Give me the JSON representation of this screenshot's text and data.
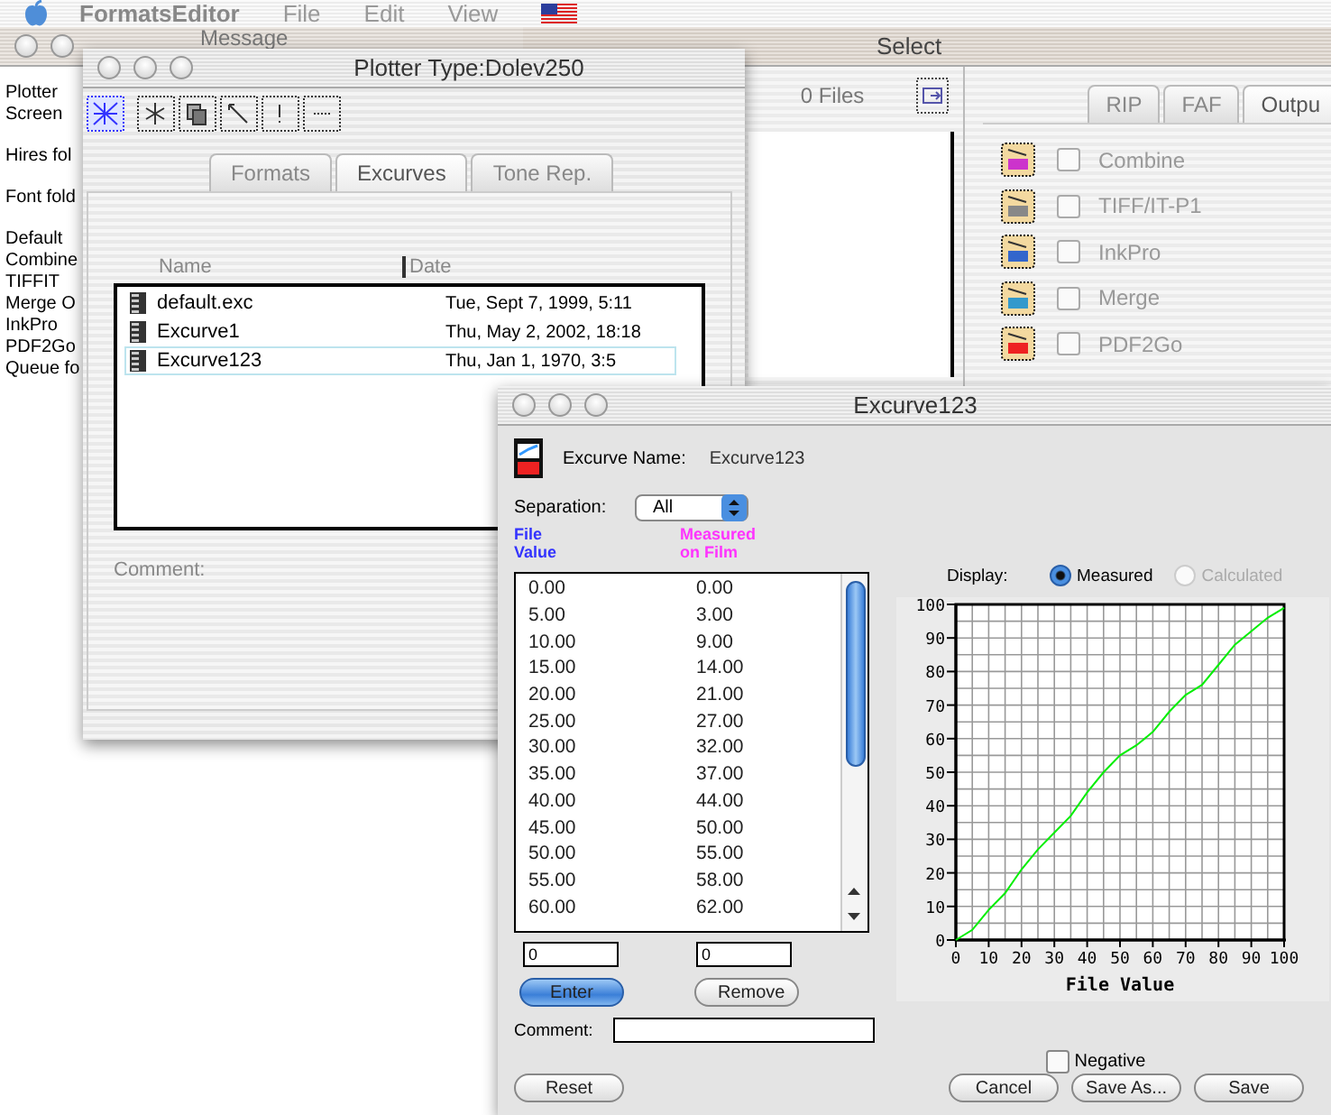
{
  "menu_bar": {
    "app_name": "FormatsEditor",
    "items": [
      "File",
      "Edit",
      "View"
    ]
  },
  "messages_window": {
    "title": "Message",
    "line_groups": [
      [
        "Plotter",
        "Screen"
      ],
      [
        "Hires fol"
      ],
      [
        "Font fold"
      ],
      [
        "Default",
        "Combine",
        "TIFFIT",
        "Merge O",
        "InkPro",
        "PDF2Go",
        "Queue fo"
      ]
    ]
  },
  "select_window": {
    "title": "Select",
    "file_count": "0 Files",
    "tabs": [
      {
        "label": "RIP",
        "selected": false
      },
      {
        "label": "FAF",
        "selected": false
      },
      {
        "label": "Outpu",
        "selected": true
      }
    ],
    "outputs": [
      {
        "label": "Combine",
        "checked": false,
        "color": "#cc33cc"
      },
      {
        "label": "TIFF/IT-P1",
        "checked": false,
        "color": "#888888"
      },
      {
        "label": "InkPro",
        "checked": false,
        "color": "#3366cc"
      },
      {
        "label": "Merge",
        "checked": false,
        "color": "#3399cc"
      },
      {
        "label": "PDF2Go",
        "checked": false,
        "color": "#ee2222"
      }
    ]
  },
  "plotter_window": {
    "title": "Plotter Type:Dolev250",
    "tabs": [
      {
        "label": "Formats",
        "selected": false
      },
      {
        "label": "Excurves",
        "selected": true
      },
      {
        "label": "Tone Rep.",
        "selected": false
      }
    ],
    "columns": [
      "Name",
      "Date"
    ],
    "files": [
      {
        "name": "default.exc",
        "date": "Tue, Sept 7, 1999, 5:11",
        "selected": false
      },
      {
        "name": "Excurve1",
        "date": "Thu, May 2, 2002, 18:18",
        "selected": false
      },
      {
        "name": "Excurve123",
        "date": "Thu, Jan 1, 1970, 3:5",
        "selected": true
      }
    ],
    "comment_label": "Comment:"
  },
  "excurve_window": {
    "title": "Excurve123",
    "name_label": "Excurve Name:",
    "name_value": "Excurve123",
    "separation_label": "Separation:",
    "separation_value": "All",
    "columns": [
      {
        "lines": [
          "File",
          "Value"
        ],
        "color": "#3333ff"
      },
      {
        "lines": [
          "Measured",
          "on Film"
        ],
        "color": "#ff33ff"
      }
    ],
    "rows": [
      [
        "0.00",
        "0.00"
      ],
      [
        "5.00",
        "3.00"
      ],
      [
        "10.00",
        "9.00"
      ],
      [
        "15.00",
        "14.00"
      ],
      [
        "20.00",
        "21.00"
      ],
      [
        "25.00",
        "27.00"
      ],
      [
        "30.00",
        "32.00"
      ],
      [
        "35.00",
        "37.00"
      ],
      [
        "40.00",
        "44.00"
      ],
      [
        "45.00",
        "50.00"
      ],
      [
        "50.00",
        "55.00"
      ],
      [
        "55.00",
        "58.00"
      ],
      [
        "60.00",
        "62.00"
      ]
    ],
    "inputs": [
      "0",
      "0"
    ],
    "row_buttons": [
      {
        "label": "Enter",
        "default": true
      },
      {
        "label": "Remove",
        "default": false
      }
    ],
    "comment_label": "Comment:",
    "display_label": "Display:",
    "display_options": [
      {
        "label": "Measured",
        "selected": true,
        "disabled": false
      },
      {
        "label": "Calculated",
        "selected": false,
        "disabled": true
      }
    ],
    "chart_data": {
      "type": "line",
      "xlabel": "File Value",
      "x": [
        0,
        5,
        10,
        15,
        20,
        25,
        30,
        35,
        40,
        45,
        50,
        55,
        60,
        65,
        70,
        75,
        80,
        85,
        90,
        95,
        100
      ],
      "grid": true,
      "series": [
        {
          "color": "#00ee00",
          "values": [
            0,
            3,
            9,
            14,
            21,
            27,
            32,
            37,
            44,
            50,
            55,
            58,
            62,
            68,
            73,
            76,
            82,
            88,
            92,
            96,
            99
          ]
        }
      ],
      "xlim": [
        0,
        100
      ],
      "ylim": [
        0,
        100
      ],
      "xticks": [
        0,
        10,
        20,
        30,
        40,
        50,
        60,
        70,
        80,
        90,
        100
      ],
      "yticks": [
        0,
        10,
        20,
        30,
        40,
        50,
        60,
        70,
        80,
        90,
        100
      ]
    },
    "negative": {
      "label": "Negative",
      "checked": false
    },
    "left_buttons": [
      {
        "label": "Reset",
        "default": false
      }
    ],
    "right_buttons": [
      {
        "label": "Cancel",
        "default": false
      },
      {
        "label": "Save As...",
        "default": false
      },
      {
        "label": "Save",
        "default": false
      }
    ]
  }
}
